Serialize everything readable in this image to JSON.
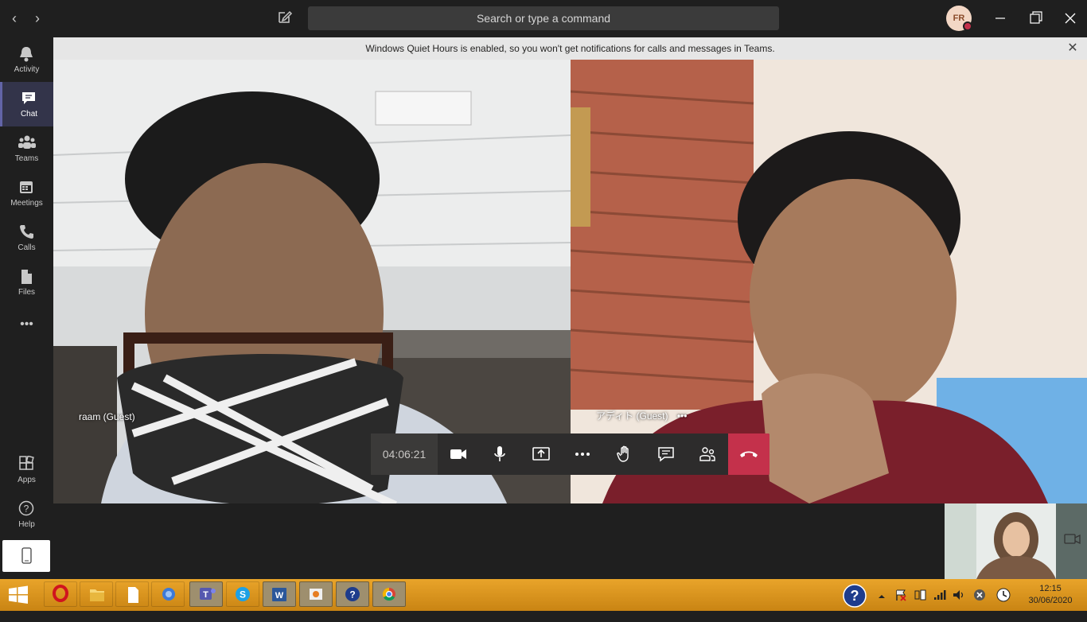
{
  "titlebar": {
    "search_placeholder": "Search or type a command",
    "user_initials": "FR"
  },
  "banner": {
    "text": "Windows Quiet Hours is enabled, so you won't get notifications for calls and messages in Teams."
  },
  "rail": {
    "items": [
      {
        "label": "Activity",
        "icon": "bell-icon",
        "active": false
      },
      {
        "label": "Chat",
        "icon": "chat-icon",
        "active": true
      },
      {
        "label": "Teams",
        "icon": "teams-icon",
        "active": false
      },
      {
        "label": "Meetings",
        "icon": "calendar-icon",
        "active": false
      },
      {
        "label": "Calls",
        "icon": "phone-icon",
        "active": false
      },
      {
        "label": "Files",
        "icon": "file-icon",
        "active": false
      }
    ],
    "more": "•••",
    "bottom": [
      {
        "label": "Apps",
        "icon": "apps-icon"
      },
      {
        "label": "Help",
        "icon": "help-icon"
      }
    ]
  },
  "call": {
    "participants": [
      {
        "name": "raam (Guest)"
      },
      {
        "name": "アディト (Guest)",
        "more": "•••"
      }
    ],
    "timer": "04:06:21",
    "controls": [
      "camera-icon",
      "microphone-icon",
      "share-screen-icon",
      "more-options-icon",
      "raise-hand-icon",
      "conversation-icon",
      "participants-icon",
      "hang-up-icon"
    ]
  },
  "taskbar": {
    "time": "12:15",
    "date": "30/06/2020"
  },
  "colors": {
    "accent": "#6264a7",
    "hangup": "#c4314b",
    "rail_bg": "#1f1f1f",
    "taskbar": "#e09a20"
  }
}
